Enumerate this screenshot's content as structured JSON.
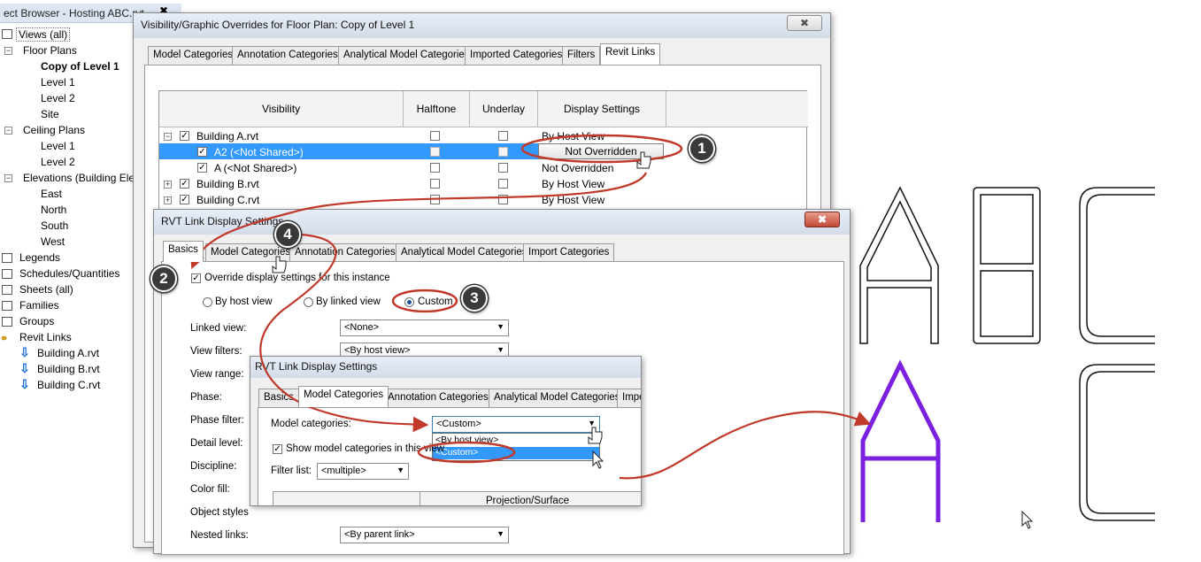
{
  "project_browser": {
    "title": "ect Browser - Hosting ABC.rvt",
    "close": "✖",
    "items": [
      {
        "label": "Views (all)"
      },
      {
        "label": "Floor Plans"
      },
      {
        "label": "Copy of Level 1"
      },
      {
        "label": "Level 1"
      },
      {
        "label": "Level 2"
      },
      {
        "label": "Site"
      },
      {
        "label": "Ceiling Plans"
      },
      {
        "label": "Level 1"
      },
      {
        "label": "Level 2"
      },
      {
        "label": "Elevations (Building Ele"
      },
      {
        "label": "East"
      },
      {
        "label": "North"
      },
      {
        "label": "South"
      },
      {
        "label": "West"
      },
      {
        "label": "Legends"
      },
      {
        "label": "Schedules/Quantities"
      },
      {
        "label": "Sheets (all)"
      },
      {
        "label": "Families"
      },
      {
        "label": "Groups"
      },
      {
        "label": "Revit Links"
      },
      {
        "label": "Building A.rvt"
      },
      {
        "label": "Building B.rvt"
      },
      {
        "label": "Building C.rvt"
      }
    ]
  },
  "vg_dialog": {
    "title": "Visibility/Graphic Overrides for Floor Plan: Copy of Level 1",
    "close": "✖",
    "tabs": [
      "Model Categories",
      "Annotation Categories",
      "Analytical Model Categories",
      "Imported Categories",
      "Filters",
      "Revit Links"
    ],
    "columns": [
      "Visibility",
      "Halftone",
      "Underlay",
      "Display Settings"
    ],
    "rows": [
      {
        "name": "Building A.rvt",
        "display": "By Host View"
      },
      {
        "name": "A2 (<Not Shared>)",
        "display": "Not Overridden"
      },
      {
        "name": "A (<Not Shared>)",
        "display": "Not Overridden"
      },
      {
        "name": "Building B.rvt",
        "display": "By Host View"
      },
      {
        "name": "Building C.rvt",
        "display": "By Host View"
      }
    ]
  },
  "rvt_dialog": {
    "title": "RVT Link Display Settings",
    "close": "✖",
    "tabs": [
      "Basics",
      "Model Categories",
      "Annotation Categories",
      "Analytical Model Categories",
      "Import Categories"
    ],
    "override_label": "Override display settings for this instance",
    "radio_host": "By host view",
    "radio_linked": "By linked view",
    "radio_custom": "Custom",
    "fields": [
      {
        "label": "Linked view:",
        "value": "<None>"
      },
      {
        "label": "View filters:",
        "value": "<By host view>"
      },
      {
        "label": "View range:"
      },
      {
        "label": "Phase:"
      },
      {
        "label": "Phase filter:"
      },
      {
        "label": "Detail level:"
      },
      {
        "label": "Discipline:"
      },
      {
        "label": "Color fill:"
      },
      {
        "label": "Object styles"
      },
      {
        "label": "Nested links:",
        "value": "<By parent link>"
      }
    ]
  },
  "rvt_dialog2": {
    "title": "RVT Link Display Settings",
    "tabs": [
      "Basics",
      "Model Categories",
      "Annotation Categories",
      "Analytical Model Categories",
      "Impo"
    ],
    "model_categories_label": "Model categories:",
    "model_categories_value": "<Custom>",
    "dropdown_options": [
      "<By host view>",
      "<Custom>"
    ],
    "show_label": "Show model categories in this view",
    "filter_label": "Filter list:",
    "filter_value": "<multiple>",
    "projection_header": "Projection/Surface"
  },
  "callouts": [
    "1",
    "2",
    "3",
    "4"
  ],
  "colors": {
    "accent": "#3399ff",
    "annotation": "#c0392b",
    "purple": "#7b1fe0"
  }
}
